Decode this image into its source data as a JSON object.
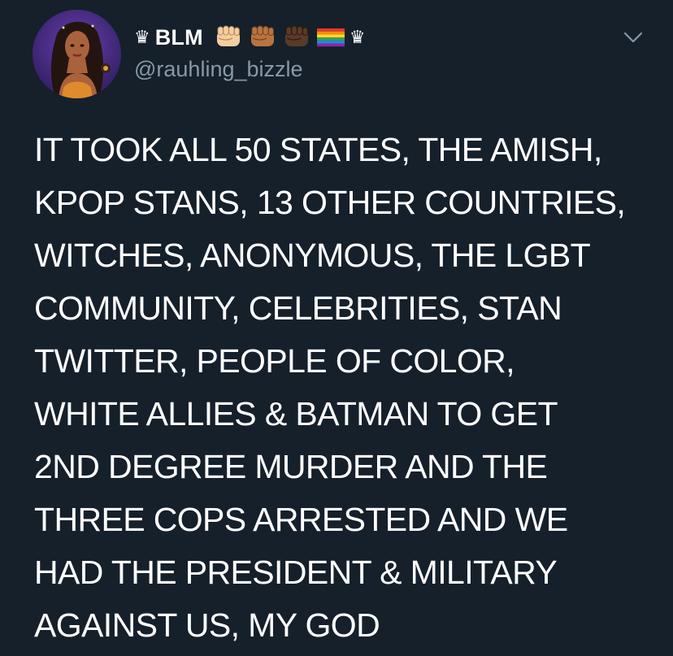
{
  "colors": {
    "background": "#15202b",
    "text_primary": "#ffffff",
    "text_secondary": "#8899a6"
  },
  "user": {
    "crown_icon_before": "♛",
    "display_name": "BLM",
    "emojis": [
      "raised-fist-light-icon",
      "raised-fist-medium-icon",
      "raised-fist-dark-icon",
      "rainbow-flag-icon"
    ],
    "crown_icon_after": "♛",
    "handle": "@rauhling_bizzle"
  },
  "tweet": {
    "lines": [
      "IT TOOK ALL 50 STATES, THE AMISH,",
      "KPOP STANS, 13 OTHER COUNTRIES,",
      "WITCHES, ANONYMOUS, THE LGBT",
      "COMMUNITY, CELEBRITIES, STAN",
      "TWITTER, PEOPLE OF COLOR,",
      "WHITE ALLIES & BATMAN TO GET",
      "2ND DEGREE MURDER AND THE",
      "THREE COPS ARRESTED AND WE",
      "HAD THE PRESIDENT & MILITARY",
      "AGAINST US, MY GOD"
    ]
  },
  "icons": {
    "menu": "chevron-down-icon",
    "avatar": "avatar"
  }
}
